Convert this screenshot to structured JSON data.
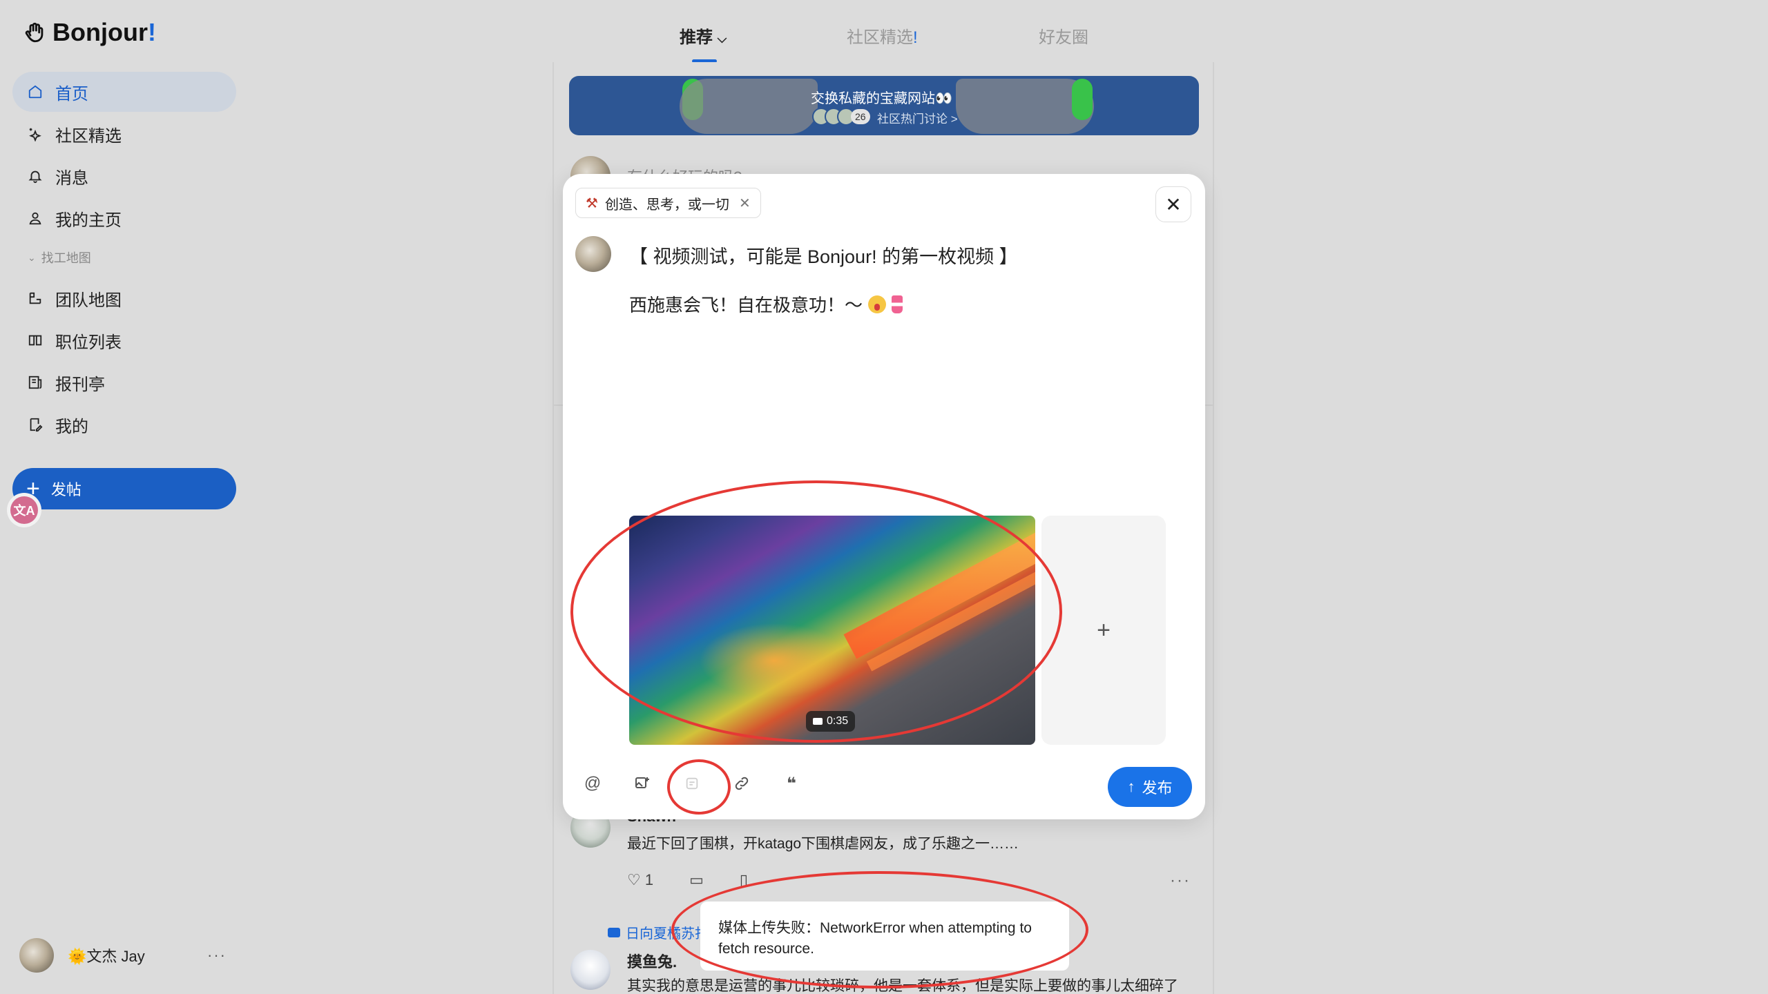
{
  "app": {
    "logo_text": "Bonjour",
    "logo_excl": "!"
  },
  "sidebar": {
    "items": [
      {
        "label": "首页",
        "icon": "home-icon",
        "active": true
      },
      {
        "label": "社区精选",
        "icon": "sparkle-icon"
      },
      {
        "label": "消息",
        "icon": "bell-icon"
      },
      {
        "label": "我的主页",
        "icon": "user-icon"
      }
    ],
    "section_label": "找工地图",
    "section_items": [
      {
        "label": "团队地图",
        "icon": "map-icon"
      },
      {
        "label": "职位列表",
        "icon": "book-icon"
      },
      {
        "label": "报刊亭",
        "icon": "newspaper-icon"
      },
      {
        "label": "我的",
        "icon": "bookmark-edit-icon"
      }
    ],
    "post_button": "发帖",
    "translate_badge": "文A",
    "user": {
      "name": "🌞文杰 Jay",
      "more": "···"
    }
  },
  "tabs": [
    {
      "label": "推荐",
      "active": true
    },
    {
      "label": "社区精选",
      "suffix": "!"
    },
    {
      "label": "好友圈"
    }
  ],
  "banner": {
    "title": "交换私藏的宝藏网站👀",
    "count": "26",
    "subtitle": "社区热门讨论 >"
  },
  "compose_hint": "有什么好玩的吗?",
  "modal": {
    "chip_label": "创造、思考，或一切",
    "title": "【 视频测试，可能是 Bonjour! 的第一枚视频 】",
    "body_text": "西施惠会飞！自在极意功！～",
    "video_duration": "0:35",
    "add_media": "+",
    "toolbar_icons": [
      "at-icon",
      "image-add-icon",
      "sticker-icon",
      "link-icon",
      "quote-icon"
    ],
    "publish_label": "发布"
  },
  "feed_posts": [
    {
      "name": "Shawn",
      "text": "最近下回了围棋，开katago下围棋虐网友，成了乐趣之一……",
      "likes": "1"
    },
    {
      "topic": "日向夏橘苏打",
      "name": "摸鱼兔.",
      "text": "其实我的意思是运营的事儿比较琐碎，他是一套体系，但是实际上要做的事儿太细碎了"
    }
  ],
  "toast": {
    "message": "媒体上传失败：NetworkError when attempting to fetch resource."
  },
  "colors": {
    "accent": "#1a66d6",
    "annotation": "#e53935",
    "publish": "#1a73e8"
  }
}
